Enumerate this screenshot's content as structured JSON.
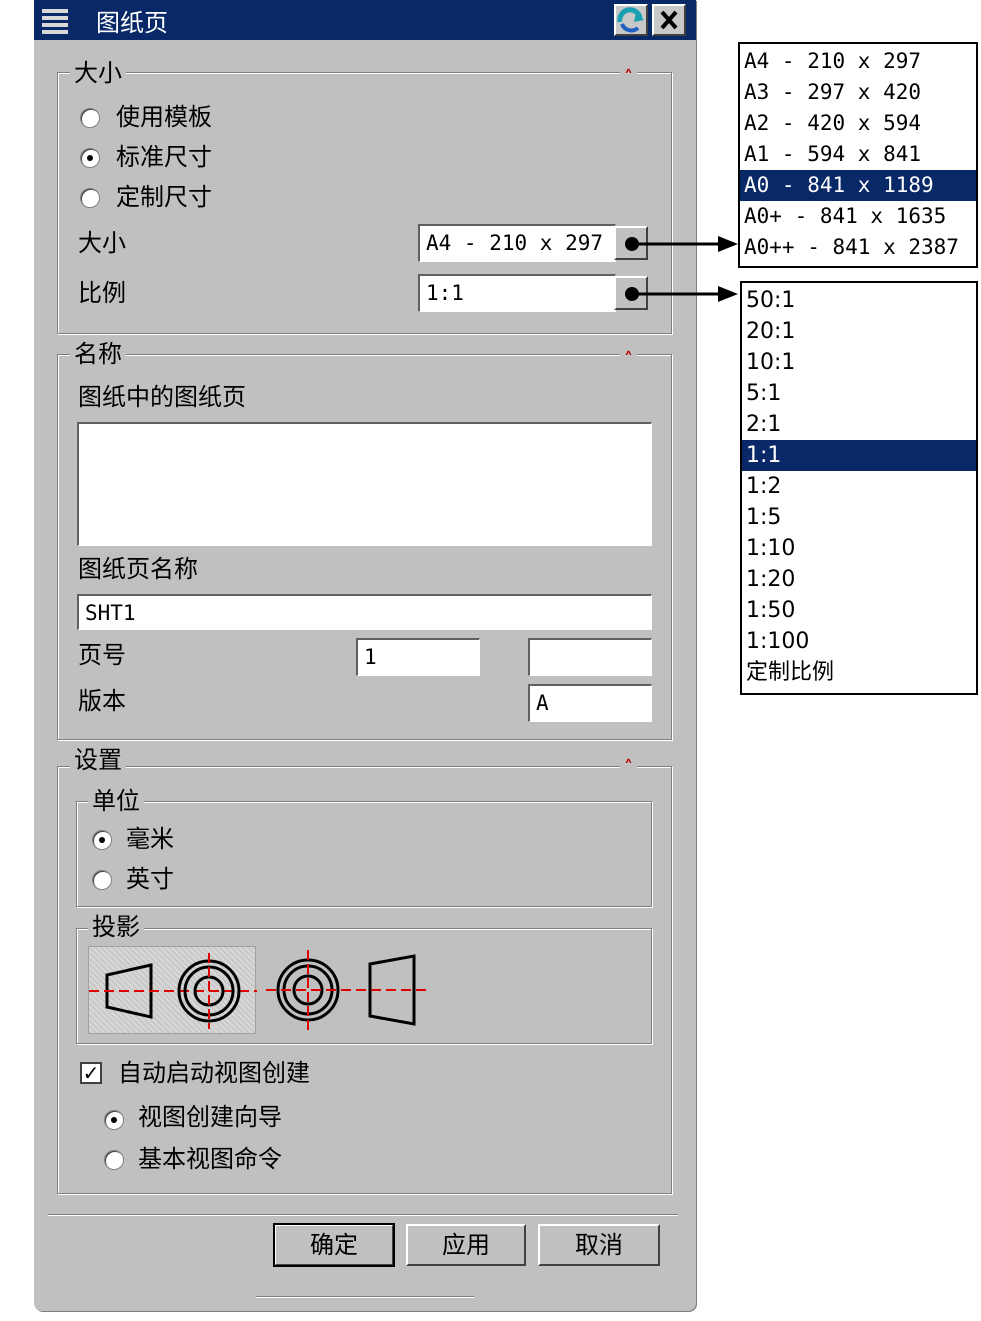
{
  "dialog": {
    "title": "图纸页",
    "reset_icon": "reset-arrow-icon",
    "close_icon": "close-icon",
    "size_group": {
      "legend": "大小",
      "options": [
        "使用模板",
        "标准尺寸",
        "定制尺寸"
      ],
      "selected_option": "标准尺寸",
      "size_label": "大小",
      "size_value": "A4 - 210 x 297",
      "scale_label": "比例",
      "scale_value": "1:1"
    },
    "name_group": {
      "legend": "名称",
      "sheets_label": "图纸中的图纸页",
      "sheet_name_label": "图纸页名称",
      "sheet_name_value": "SHT1",
      "page_label": "页号",
      "page_value": "1",
      "page_value2": "",
      "revision_label": "版本",
      "revision_value": "A"
    },
    "settings_group": {
      "legend": "设置",
      "units_legend": "单位",
      "units": [
        "毫米",
        "英寸"
      ],
      "selected_unit": "毫米",
      "projection_legend": "投影",
      "projection_icons": [
        "first-angle-projection-icon",
        "third-angle-projection-icon"
      ],
      "auto_view_label": "自动启动视图创建",
      "auto_view_checked": true,
      "view_options": [
        "视图创建向导",
        "基本视图命令"
      ],
      "selected_view_option": "视图创建向导"
    },
    "buttons": {
      "ok": "确定",
      "apply": "应用",
      "cancel": "取消"
    }
  },
  "size_dropdown": {
    "items": [
      "A4 - 210 x 297",
      "A3 - 297 x 420",
      "A2 - 420 x 594",
      "A1 - 594 x 841",
      "A0 - 841 x 1189",
      "A0+ - 841 x 1635",
      "A0++ - 841 x 2387"
    ],
    "selected": "A0 - 841 x 1189"
  },
  "scale_dropdown": {
    "items": [
      "50:1",
      "20:1",
      "10:1",
      "5:1",
      "2:1",
      "1:1",
      "1:2",
      "1:5",
      "1:10",
      "1:20",
      "1:50",
      "1:100",
      "定制比例"
    ],
    "selected": "1:1"
  },
  "colors": {
    "title_bar": "#082868",
    "selection": "#082868",
    "chevron": "#c00000",
    "projection_line": "#e00000"
  }
}
